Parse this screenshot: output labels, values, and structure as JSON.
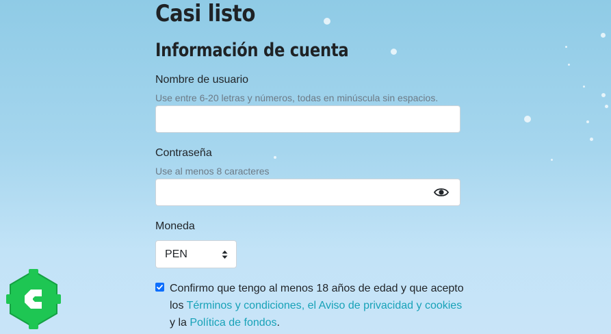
{
  "page": {
    "title": "Casi listo",
    "section_title": "Información de cuenta"
  },
  "username": {
    "label": "Nombre de usuario",
    "hint": "Use entre 6-20 letras y números, todas en minúscula sin espacios.",
    "value": ""
  },
  "password": {
    "label": "Contraseña",
    "hint": "Use al menos 8 caracteres",
    "value": "",
    "toggle_icon": "eye-icon"
  },
  "currency": {
    "label": "Moneda",
    "selected": "PEN"
  },
  "consent": {
    "checked": true,
    "text_1": "Confirmo que tengo al menos 18 años de edad y que acepto los ",
    "terms_link": "Términos y condiciones",
    "sep": ", ",
    "privacy_link": "el Aviso de privacidad y cookies",
    "text_2": " y la ",
    "funds_link": "Política de fondos",
    "text_3": "."
  },
  "colors": {
    "link": "#17a2b8",
    "checkbox": "#0d6efd",
    "logo_green": "#1ec653"
  }
}
